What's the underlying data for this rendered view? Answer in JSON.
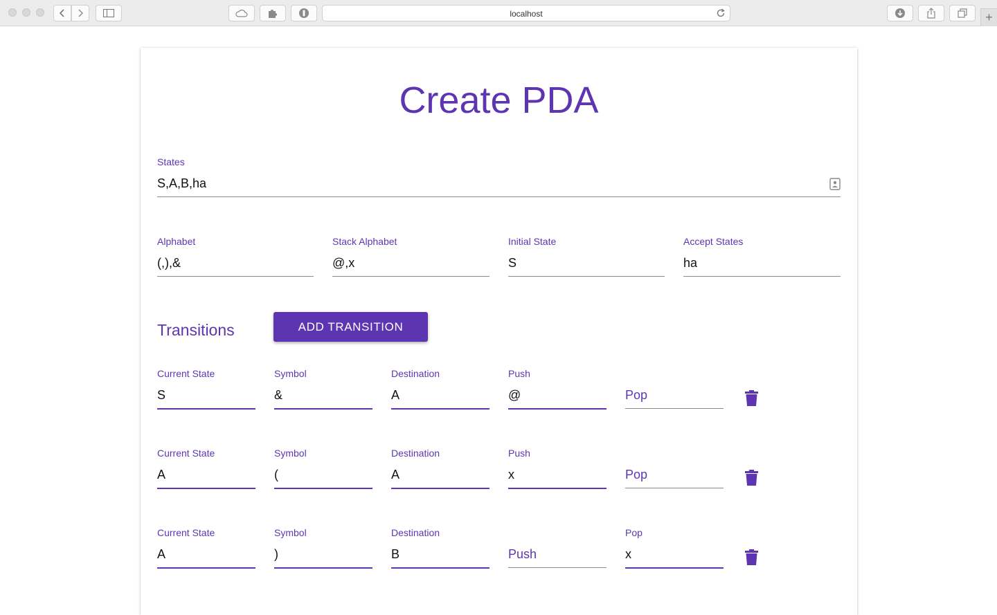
{
  "browser": {
    "url": "localhost"
  },
  "page": {
    "title": "Create PDA",
    "states": {
      "label": "States",
      "value": "S,A,B,ha"
    },
    "alphabet": {
      "label": "Alphabet",
      "value": "(,),&"
    },
    "stack_alphabet": {
      "label": "Stack Alphabet",
      "value": "@,x"
    },
    "initial_state": {
      "label": "Initial State",
      "value": "S"
    },
    "accept_states": {
      "label": "Accept States",
      "value": "ha"
    },
    "transitions_title": "Transitions",
    "add_transition_label": "ADD TRANSITION",
    "transitions": [
      {
        "current_state": {
          "label": "Current State",
          "value": "S"
        },
        "symbol": {
          "label": "Symbol",
          "value": "&"
        },
        "destination": {
          "label": "Destination",
          "value": "A"
        },
        "push": {
          "label": "Push",
          "value": "@"
        },
        "pop": {
          "placeholder": "Pop"
        }
      },
      {
        "current_state": {
          "label": "Current State",
          "value": "A"
        },
        "symbol": {
          "label": "Symbol",
          "value": "("
        },
        "destination": {
          "label": "Destination",
          "value": "A"
        },
        "push": {
          "label": "Push",
          "value": "x"
        },
        "pop": {
          "placeholder": "Pop"
        }
      },
      {
        "current_state": {
          "label": "Current State",
          "value": "A"
        },
        "symbol": {
          "label": "Symbol",
          "value": ")"
        },
        "destination": {
          "label": "Destination",
          "value": "B"
        },
        "push": {
          "placeholder": "Push"
        },
        "pop": {
          "label": "Pop",
          "value": "x"
        }
      }
    ]
  },
  "theme": {
    "accent": "#5e35b1"
  }
}
